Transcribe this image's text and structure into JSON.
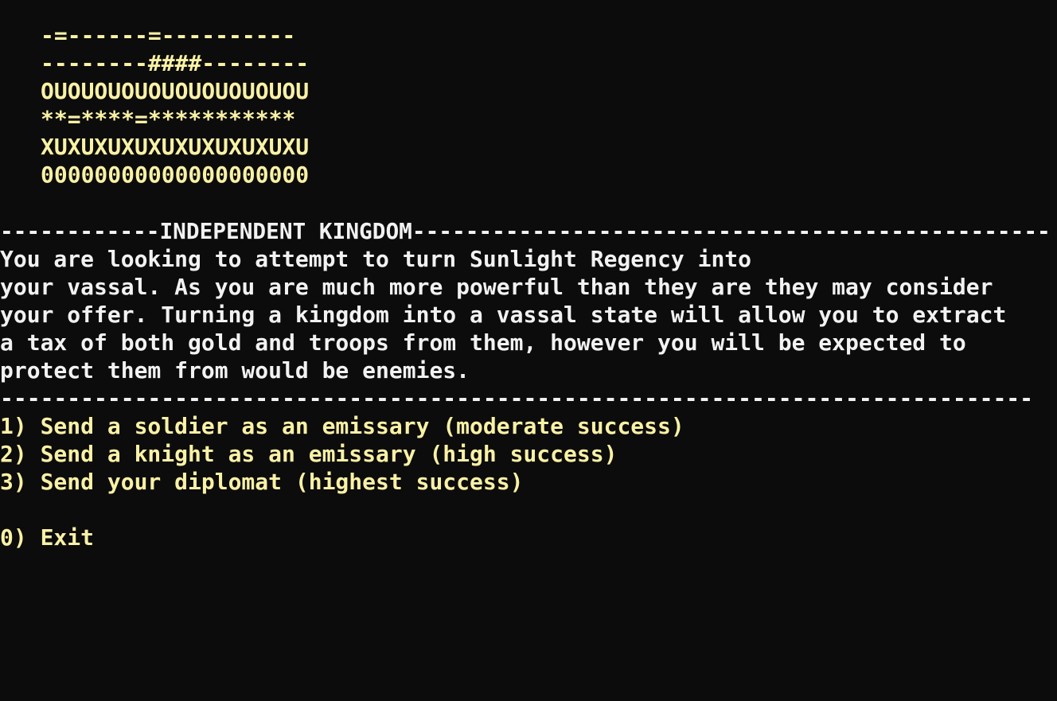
{
  "colors": {
    "background": "#0c0c0c",
    "text": "#f2f2f2",
    "highlight": "#f9f1a5"
  },
  "banner": [
    "-=------=----------",
    "--------####--------",
    "OUOUOUOUOUOUOUOUOUOU",
    "**=****=***********",
    "XUXUXUXUXUXUXUXUXUXU",
    "00000000000000000000"
  ],
  "header": "------------INDEPENDENT KINGDOM------------------------------------------------",
  "description": [
    "You are looking to attempt to turn Sunlight Regency into",
    "your vassal. As you are much more powerful than they are they may consider",
    "your offer. Turning a kingdom into a vassal state will allow you to extract",
    "a tax of both gold and troops from them, however you will be expected to",
    "protect them from would be enemies."
  ],
  "divider": "-----------------------------------------------------------------------------",
  "options": [
    "1) Send a soldier as an emissary (moderate success)",
    "2) Send a knight as an emissary (high success)",
    "3) Send your diplomat (highest success)"
  ],
  "exit_option": "0) Exit"
}
